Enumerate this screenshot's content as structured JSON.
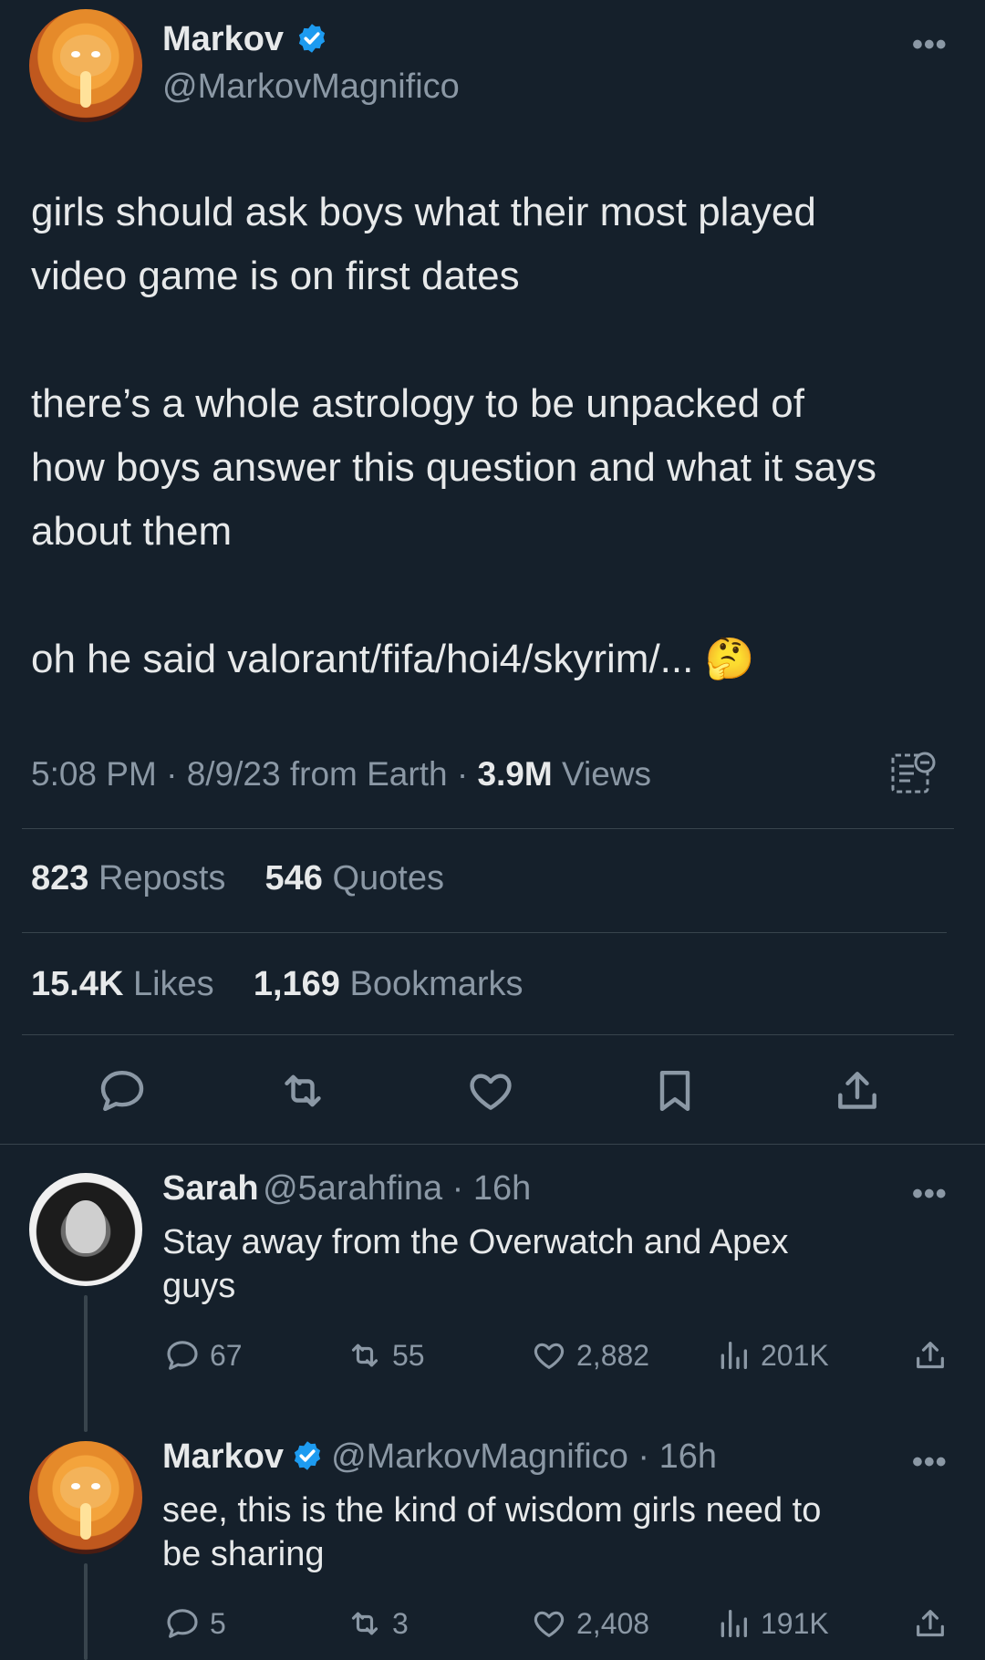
{
  "tweet": {
    "author_name": "Markov",
    "author_handle": "@MarkovMagnifico",
    "more_glyph": "•••",
    "paragraphs": [
      "girls should ask boys what their most played\nvideo game is on first dates",
      "there’s a whole astrology to be unpacked of\nhow boys answer this question and what it says\nabout them",
      "oh he said valorant/fifa/hoi4/skyrim/... 🤔"
    ],
    "time": "5:08 PM",
    "date": "8/9/23",
    "source": "from Earth",
    "views_count": "3.9M",
    "views_label": "Views",
    "reposts_count": "823",
    "reposts_label": "Reposts",
    "quotes_count": "546",
    "quotes_label": "Quotes",
    "likes_count": "15.4K",
    "likes_label": "Likes",
    "bookmarks_count": "1,169",
    "bookmarks_label": "Bookmarks",
    "action_icons": [
      "reply-icon",
      "repost-icon",
      "like-icon",
      "bookmark-icon",
      "share-icon"
    ]
  },
  "replies": [
    {
      "name": "Sarah",
      "handle": "@5arahfina",
      "time": "16h",
      "verified": false,
      "text": "Stay away from the Overwatch and Apex\nguys",
      "replies": "67",
      "reposts": "55",
      "likes": "2,882",
      "views": "201K"
    },
    {
      "name": "Markov",
      "handle": "@MarkovMagnifico",
      "time": "16h",
      "verified": true,
      "text": "see, this is the kind of wisdom girls need to\nbe sharing",
      "replies": "5",
      "reposts": "3",
      "likes": "2,408",
      "views": "191K"
    }
  ],
  "colors": {
    "background": "#15202b",
    "text": "#e7e9ea",
    "secondary": "#8b98a5",
    "verified": "#1d9bf0",
    "divider": "#38444d"
  }
}
